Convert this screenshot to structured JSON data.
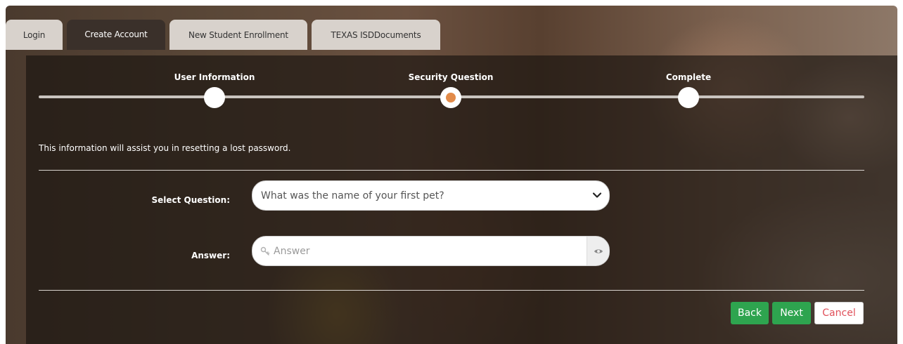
{
  "tabs": [
    {
      "label": "Login",
      "active": false
    },
    {
      "label": "Create Account",
      "active": true
    },
    {
      "label": "New Student Enrollment",
      "active": false
    },
    {
      "label": "TEXAS ISDDocuments",
      "active": false
    }
  ],
  "stepper": {
    "steps": [
      {
        "label": "User Information",
        "state": "done"
      },
      {
        "label": "Security Question",
        "state": "current"
      },
      {
        "label": "Complete",
        "state": "pending"
      }
    ],
    "accent_color": "#e28b4a"
  },
  "info_text": "This information will assist you in resetting a lost password.",
  "form": {
    "question_label": "Select Question:",
    "question_value": "What was the name of your first pet?",
    "answer_label": "Answer:",
    "answer_placeholder": "Answer",
    "answer_value": ""
  },
  "buttons": {
    "back": "Back",
    "next": "Next",
    "cancel": "Cancel"
  },
  "icons": {
    "question_dropdown": "chevron-down-icon",
    "answer_prefix": "key-icon",
    "answer_toggle": "eye-icon"
  },
  "colors": {
    "primary_button": "#2ea44f",
    "cancel_text": "#e0505a"
  }
}
